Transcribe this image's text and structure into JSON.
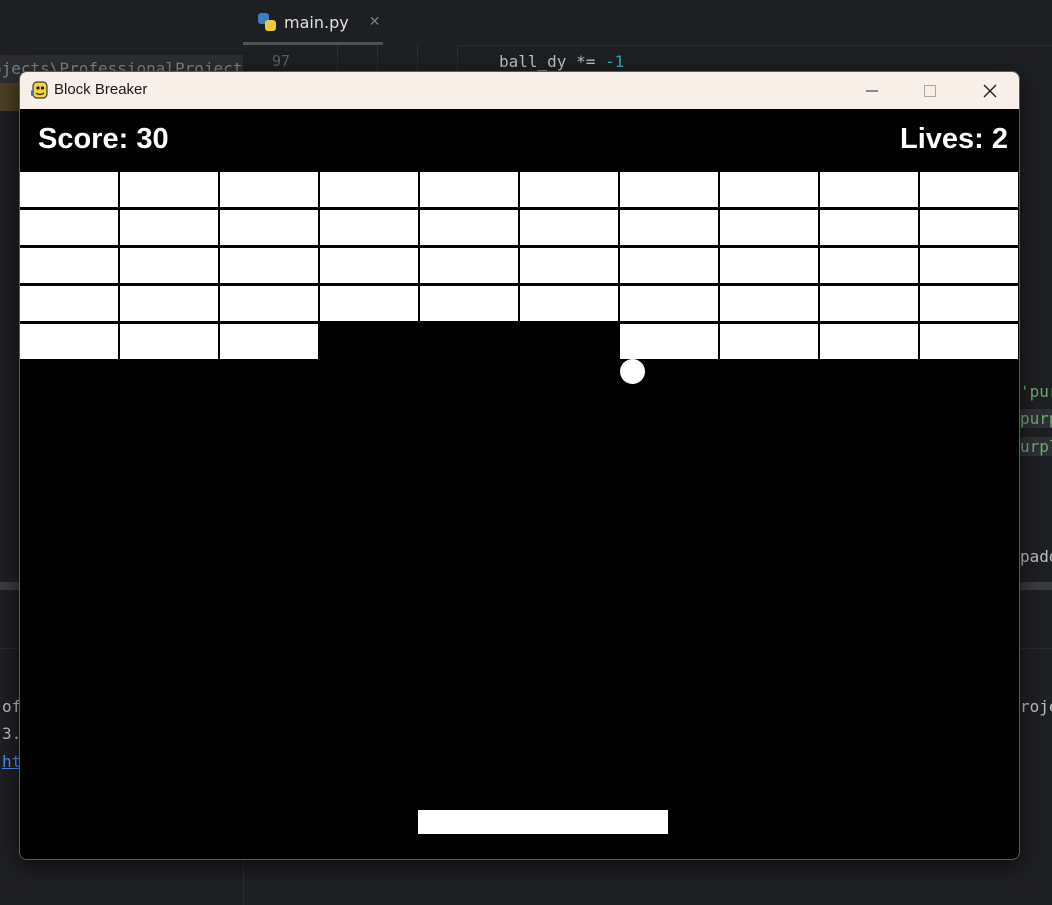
{
  "ide": {
    "tab_label": "main.py",
    "tab_close": "✕",
    "path_fragment": "ojects\\ProfessionalProjects\\bric",
    "line_number": "97",
    "code_text": "ball_dy *= ",
    "code_number": "-1",
    "right_fragments": [
      "'pur",
      "purp",
      "urpl",
      "padd"
    ],
    "right_console": "roje",
    "console_fragments": [
      "of",
      "3.",
      "ht"
    ]
  },
  "window": {
    "title": "Block Breaker",
    "controls": {
      "minimize": "minimize",
      "maximize": "maximize",
      "close": "close"
    }
  },
  "game": {
    "score_text": "Score: 30",
    "lives_text": "Lives: 2",
    "brick_grid": {
      "rows": 5,
      "cols": 10,
      "present": [
        [
          1,
          1,
          1,
          1,
          1,
          1,
          1,
          1,
          1,
          1
        ],
        [
          1,
          1,
          1,
          1,
          1,
          1,
          1,
          1,
          1,
          1
        ],
        [
          1,
          1,
          1,
          1,
          1,
          1,
          1,
          1,
          1,
          1
        ],
        [
          1,
          1,
          1,
          1,
          1,
          1,
          1,
          1,
          1,
          1
        ],
        [
          1,
          1,
          1,
          0,
          0,
          0,
          1,
          1,
          1,
          1
        ]
      ]
    },
    "colors": {
      "background": "#000000",
      "bricks": "#ffffff",
      "ball": "#ffffff",
      "paddle": "#ffffff"
    }
  }
}
